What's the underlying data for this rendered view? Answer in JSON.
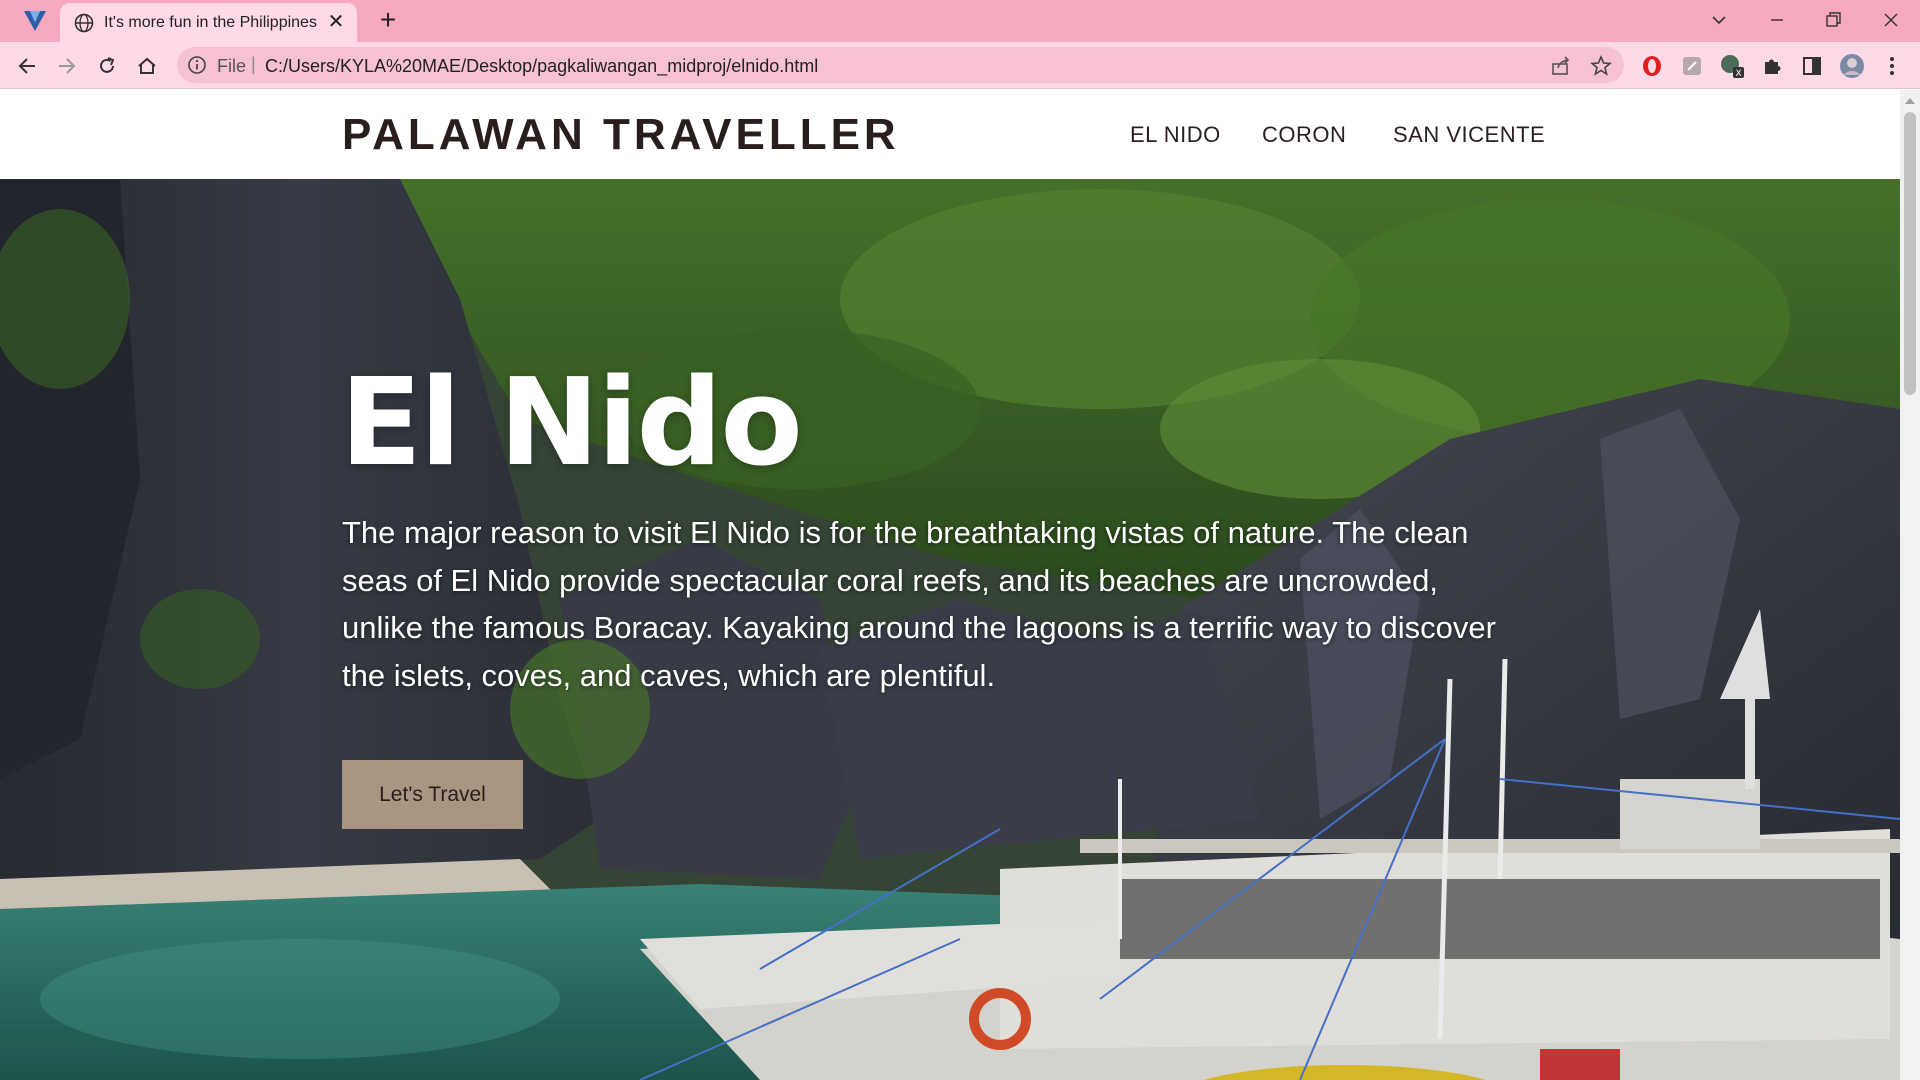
{
  "browser": {
    "tab_title": "It's more fun in the Philippines",
    "address_scheme": "File",
    "address_url": "C:/Users/KYLA%20MAE/Desktop/pagkaliwangan_midproj/elnido.html",
    "tab_close": "✕",
    "new_tab": "+"
  },
  "site": {
    "brand": "PALAWAN TRAVELLER",
    "menu": [
      "EL NIDO",
      "CORON",
      "SAN VICENTE"
    ]
  },
  "hero": {
    "title": "El Nido",
    "description": "The major reason to visit El Nido is for the breathtaking vistas of nature. The clean seas of El Nido provide spectacular coral reefs, and its beaches are uncrowded, unlike the famous Boracay. Kayaking around the lagoons is a terrific way to discover the islets, coves, and caves, which are plentiful.",
    "button": "Let's Travel"
  },
  "colors": {
    "tabbar": "#f7a9c0",
    "toolbar": "#ffd9e6",
    "brand_text": "#2a1d1d",
    "cta_bg": "#a99682"
  }
}
